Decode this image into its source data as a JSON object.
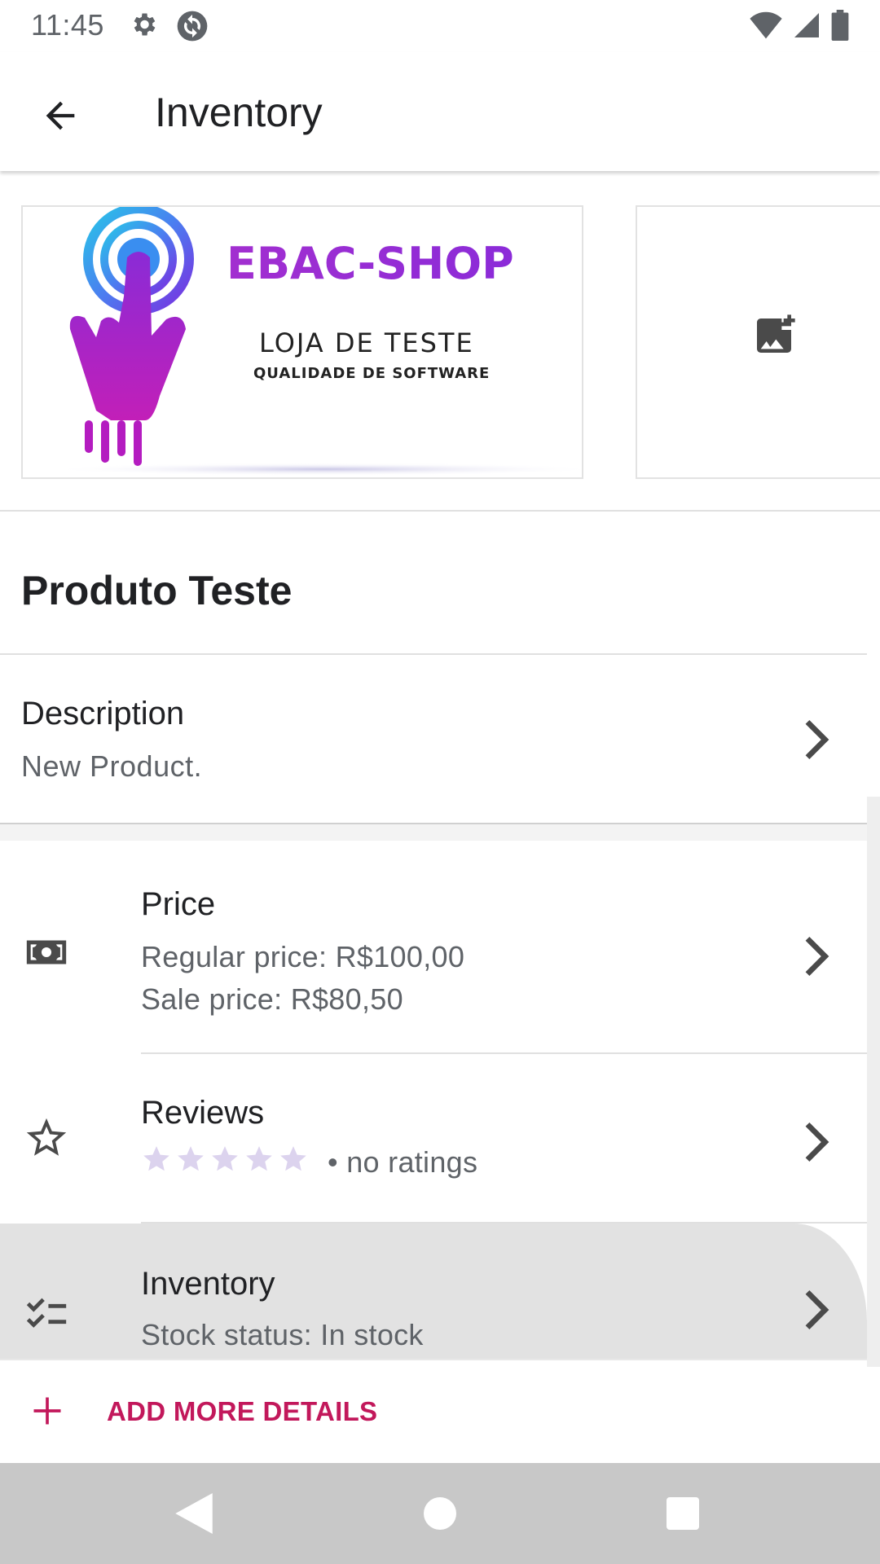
{
  "status_bar": {
    "time": "11:45",
    "left_icons": [
      "settings-icon",
      "sync-icon"
    ],
    "right_icons": [
      "wifi-icon",
      "signal-icon",
      "battery-icon"
    ]
  },
  "app_bar": {
    "title": "Inventory",
    "back_icon": "arrow-back-icon"
  },
  "images": {
    "logo_brand": "EBAC-SHOP",
    "logo_line1": "LOJA DE TESTE",
    "logo_line2": "QUALIDADE DE SOFTWARE",
    "add_image_icon": "add-photo-icon"
  },
  "product": {
    "title": "Produto Teste"
  },
  "description": {
    "label": "Description",
    "value": "New Product."
  },
  "rows": {
    "price": {
      "label": "Price",
      "regular": "Regular price: R$100,00",
      "sale": "Sale price: R$80,50",
      "icon": "money-icon"
    },
    "reviews": {
      "label": "Reviews",
      "ratings_text": "• no ratings",
      "stars": 0,
      "star_count": 5,
      "icon": "star-outline-icon"
    },
    "inventory": {
      "label": "Inventory",
      "stock": "Stock status: In stock",
      "icon": "checklist-icon"
    }
  },
  "add_details": {
    "label": "ADD MORE DETAILS",
    "icon": "plus-icon"
  },
  "nav": {
    "back": "nav-back-icon",
    "home": "nav-home-icon",
    "recents": "nav-recents-icon"
  },
  "colors": {
    "accent": "#c2185b",
    "star_empty": "#dcd3ee",
    "row_pressed": "#e2e2e2",
    "nav_bar": "#c8c8c8"
  }
}
